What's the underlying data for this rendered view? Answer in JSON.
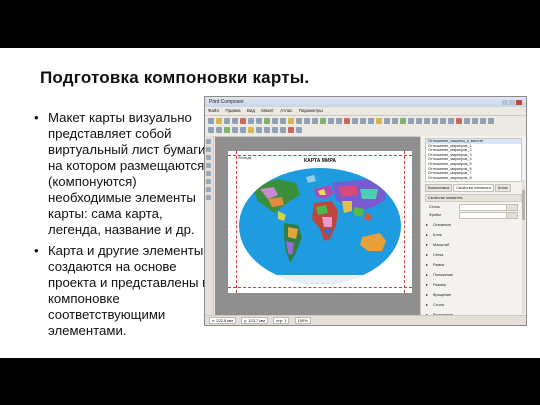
{
  "slide": {
    "title": "Подготовка компоновки карты.",
    "bullets": [
      "Макет карты визуально представляет собой виртуальный лист бумаги, на котором размещаются (компонуются) необходимые элементы карты: сама карта, легенда, название и др.",
      "Карта и другие элементы создаются на основе проекта и представлены в компоновке соответствующими элементами."
    ]
  },
  "screenshot": {
    "window_title": "Print Composer",
    "menu": [
      "Файл",
      "Правка",
      "Вид",
      "Макет",
      "Атлас",
      "Параметры"
    ],
    "map_title": "КАРТА МИРА",
    "legend_text": "Легенда",
    "panel_list": [
      "Отношение_ширины_к_высоте",
      "Отношение_маркеров_1",
      "Отношение_маркеров_2",
      "Отношение_маркеров_3",
      "Отношение_маркеров_4",
      "Отношение_маркеров_5",
      "Отношение_маркеров_6",
      "Отношение_маркеров_7",
      "Отношение_маркеров_8"
    ],
    "panel_tabs": [
      "Компоновка",
      "Свойства элемента",
      "Атлас"
    ],
    "panel_section": "Свойства элемента",
    "panel_rows": [
      "Стиль",
      "Фрейм"
    ],
    "panel_items": [
      "Основные",
      "Блок",
      "Масштаб",
      "Сетка",
      "Рамка",
      "Положение",
      "Размер",
      "Вращение",
      "Стили",
      "Выделение"
    ],
    "status": [
      "x: 222.5 мм",
      "y: 123.7 мм",
      "стр: 1",
      "100%"
    ],
    "colors": {
      "ocean": "#1f9be0",
      "guide": "#d04040"
    }
  }
}
